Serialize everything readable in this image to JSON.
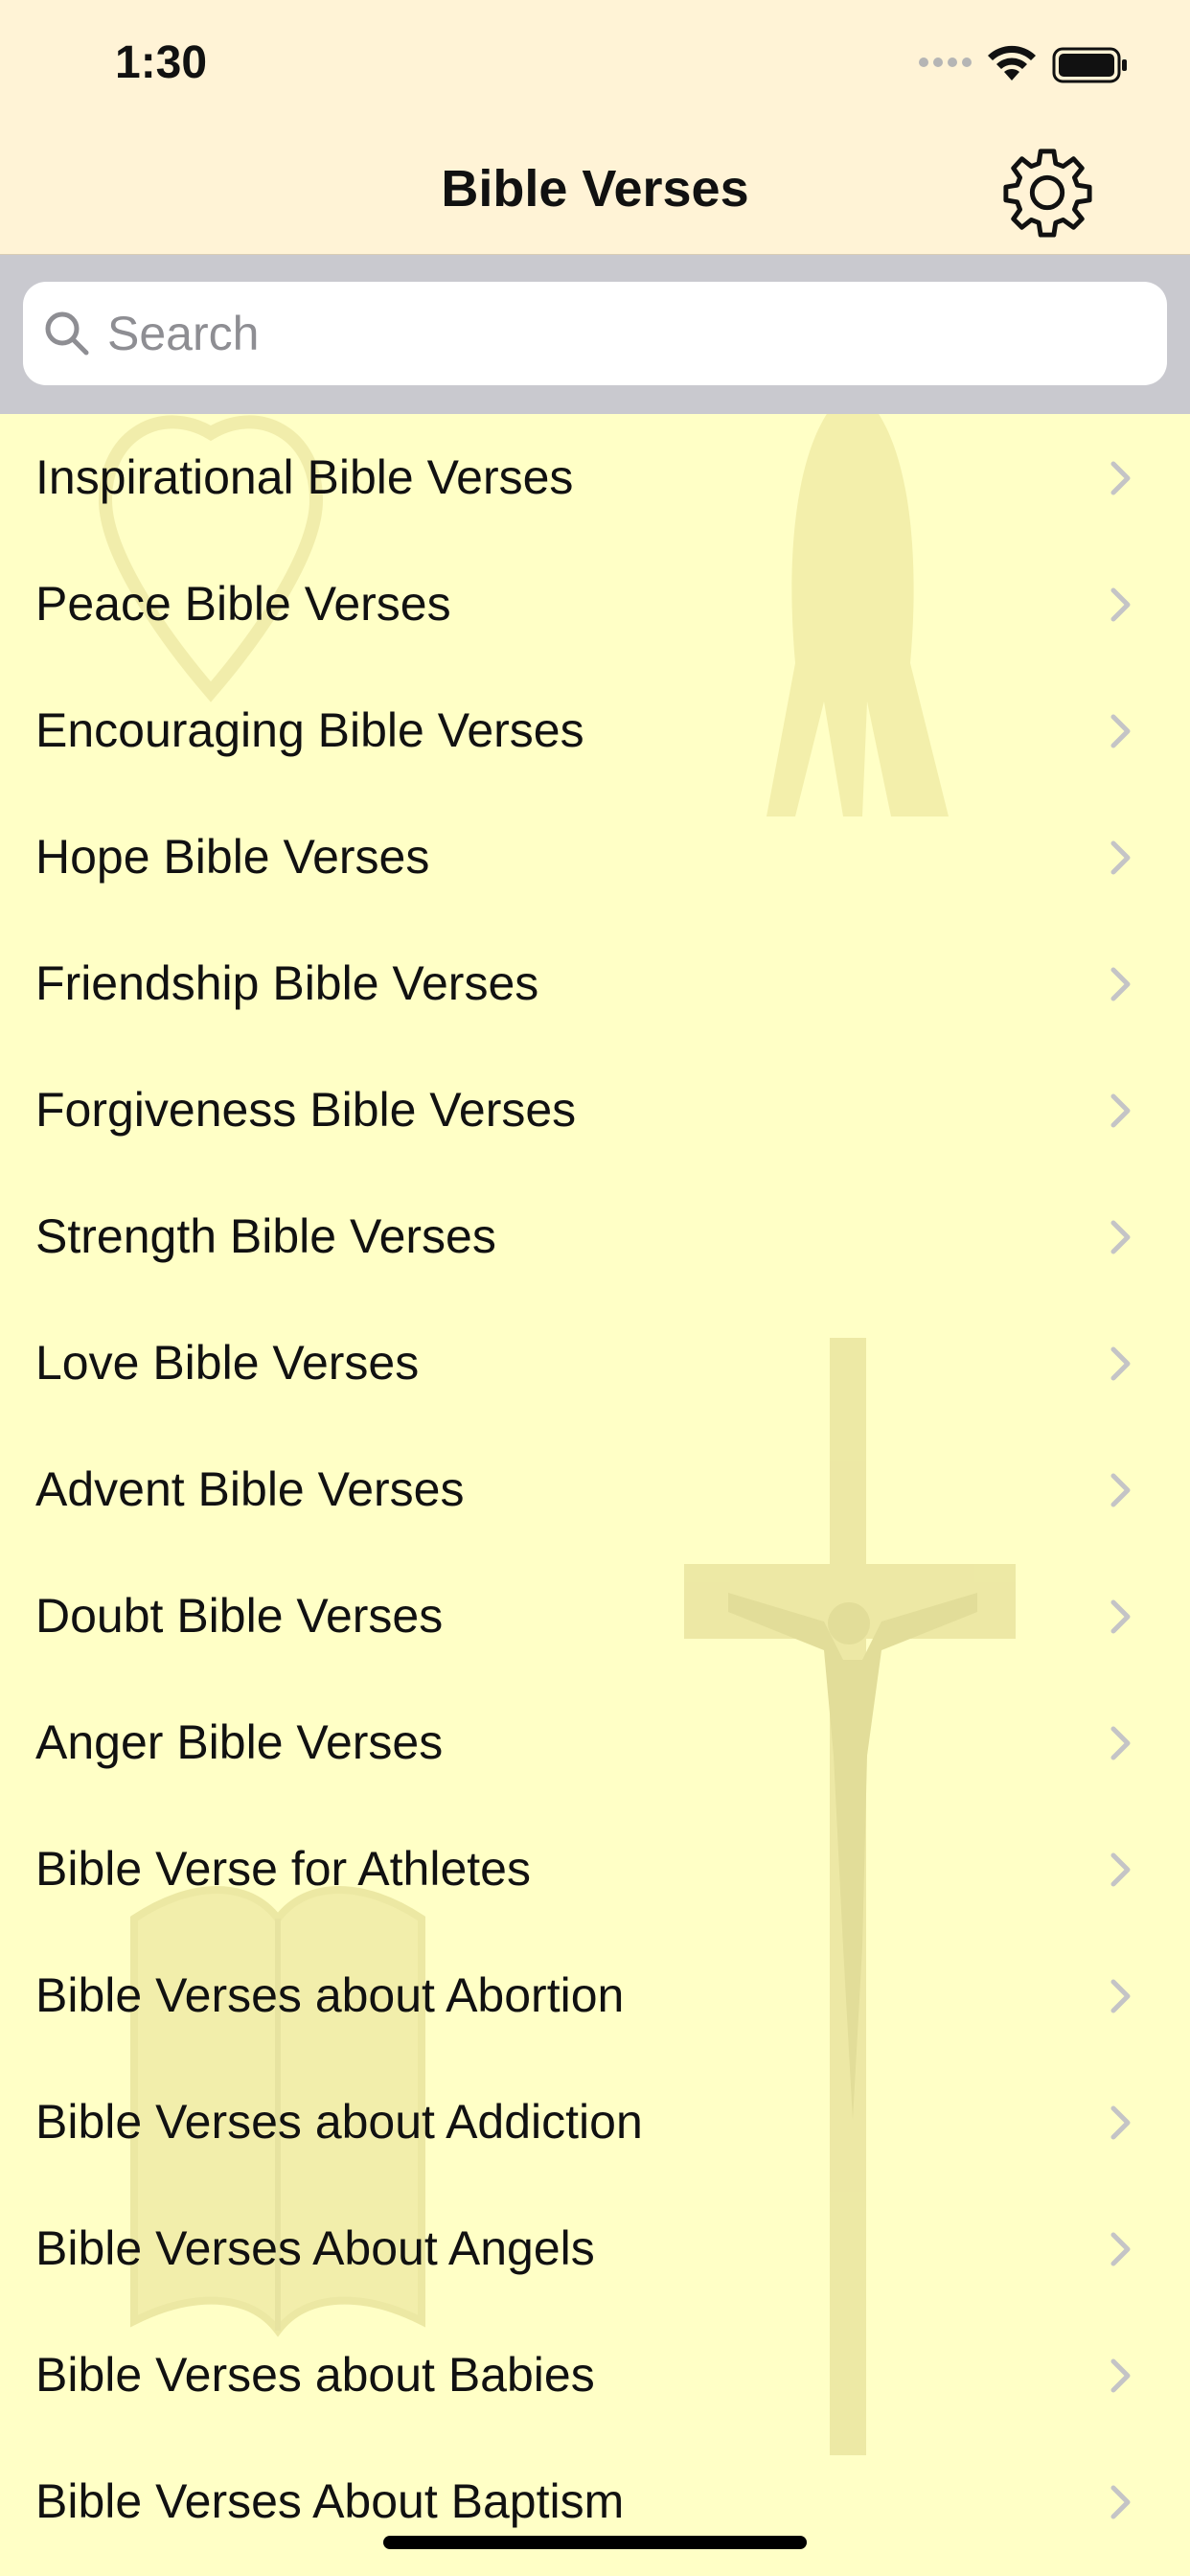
{
  "status": {
    "time": "1:30",
    "icons": [
      "signal-icon",
      "wifi-icon",
      "battery-icon"
    ]
  },
  "nav": {
    "title": "Bible Verses",
    "settings_icon": "gear-icon"
  },
  "search": {
    "placeholder": "Search",
    "value": ""
  },
  "colors": {
    "background": "#ffffc6",
    "header": "#fff3d6",
    "search_bar": "#c9c9cf",
    "watermark": "#eeeaa0"
  },
  "items": [
    {
      "label": "Inspirational Bible Verses"
    },
    {
      "label": "Peace Bible Verses"
    },
    {
      "label": "Encouraging Bible Verses"
    },
    {
      "label": "Hope Bible Verses"
    },
    {
      "label": "Friendship Bible Verses"
    },
    {
      "label": "Forgiveness Bible Verses"
    },
    {
      "label": "Strength Bible Verses"
    },
    {
      "label": "Love Bible Verses"
    },
    {
      "label": "Advent Bible Verses"
    },
    {
      "label": "Doubt Bible Verses"
    },
    {
      "label": "Anger Bible Verses"
    },
    {
      "label": "Bible Verse for Athletes"
    },
    {
      "label": "Bible Verses about Abortion"
    },
    {
      "label": "Bible Verses about Addiction"
    },
    {
      "label": "Bible Verses About Angels"
    },
    {
      "label": "Bible Verses about Babies"
    },
    {
      "label": "Bible Verses About Baptism"
    }
  ]
}
